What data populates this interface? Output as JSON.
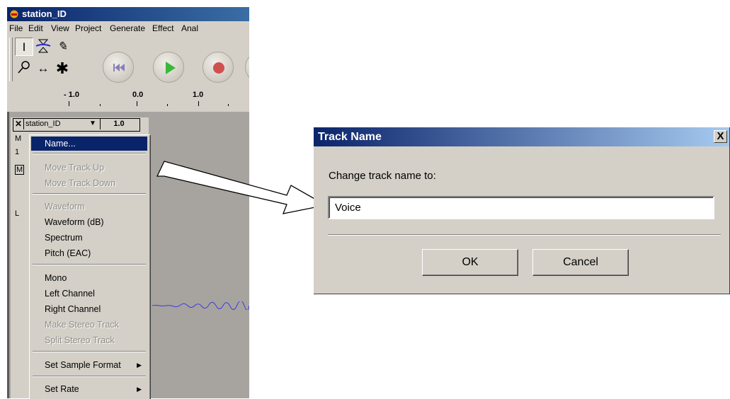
{
  "app": {
    "title": "station_ID",
    "menu": [
      "File",
      "Edit",
      "View",
      "Project",
      "Generate",
      "Effect",
      "Anal"
    ],
    "ruler": {
      "labels": [
        "- 1.0",
        "0.0",
        "1.0"
      ]
    },
    "track": {
      "name": "station_ID",
      "dropdown_icon": "triangle-down-icon",
      "scale_label": "1.0",
      "panel_fragments": [
        "M",
        "1",
        "M",
        "L"
      ]
    }
  },
  "popup_menu": {
    "items": [
      {
        "label": "Name...",
        "state": "selected"
      },
      {
        "label": "Move Track Up",
        "state": "disabled"
      },
      {
        "label": "Move Track Down",
        "state": "disabled"
      },
      {
        "label": "Waveform",
        "state": "disabled"
      },
      {
        "label": "Waveform (dB)",
        "state": "enabled"
      },
      {
        "label": "Spectrum",
        "state": "enabled"
      },
      {
        "label": "Pitch (EAC)",
        "state": "enabled"
      },
      {
        "label": "Mono",
        "state": "enabled"
      },
      {
        "label": "Left Channel",
        "state": "enabled"
      },
      {
        "label": "Right Channel",
        "state": "enabled"
      },
      {
        "label": "Make Stereo Track",
        "state": "disabled"
      },
      {
        "label": "Split Stereo Track",
        "state": "disabled"
      },
      {
        "label": "Set Sample Format",
        "state": "enabled",
        "submenu": true
      },
      {
        "label": "Set Rate",
        "state": "enabled",
        "submenu": true
      }
    ]
  },
  "dialog": {
    "title": "Track Name",
    "close_label": "X",
    "prompt": "Change track name to:",
    "input_value": "Voice",
    "ok_label": "OK",
    "cancel_label": "Cancel"
  },
  "colors": {
    "selection_blue": "#0a246a",
    "window_gray": "#d4d0c8",
    "disabled_text": "#8f8d88",
    "waveform": "#3a3ae0"
  }
}
